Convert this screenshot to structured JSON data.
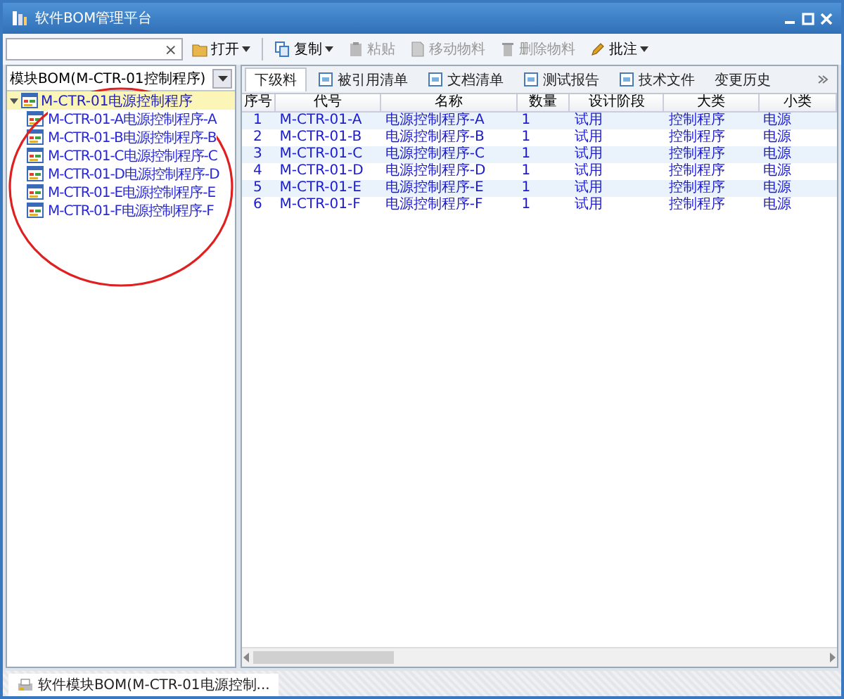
{
  "window": {
    "title": "软件BOM管理平台"
  },
  "toolbar": {
    "search": {
      "clear": "×"
    },
    "buttons": [
      {
        "label": "打开",
        "kind": "folder",
        "dropdown": true,
        "disabled": false
      },
      {
        "label": "复制",
        "kind": "copy",
        "dropdown": true,
        "disabled": false
      },
      {
        "label": "粘贴",
        "kind": "paste",
        "dropdown": false,
        "disabled": true
      },
      {
        "label": "移动物料",
        "kind": "doc",
        "dropdown": false,
        "disabled": true
      },
      {
        "label": "删除物料",
        "kind": "trash",
        "dropdown": false,
        "disabled": true
      },
      {
        "label": "批注",
        "kind": "note",
        "dropdown": true,
        "disabled": false
      }
    ]
  },
  "left_panel": {
    "selector": {
      "value": "模块BOM(M-CTR-01控制程序)"
    },
    "tree": [
      {
        "label": "M-CTR-01电源控制程序",
        "expanded": true,
        "children": [
          {
            "label": "M-CTR-01-A电源控制程序-A"
          },
          {
            "label": "M-CTR-01-B电源控制程序-B"
          },
          {
            "label": "M-CTR-01-C电源控制程序-C"
          },
          {
            "label": "M-CTR-01-D电源控制程序-D"
          },
          {
            "label": "M-CTR-01-E电源控制程序-E"
          },
          {
            "label": "M-CTR-01-F电源控制程序-F"
          }
        ]
      }
    ]
  },
  "tabs": [
    {
      "label": "下级料",
      "icon": false,
      "selected": true
    },
    {
      "label": "被引用清单",
      "icon": true,
      "selected": false
    },
    {
      "label": "文档清单",
      "icon": true,
      "selected": false
    },
    {
      "label": "测试报告",
      "icon": true,
      "selected": false
    },
    {
      "label": "技术文件",
      "icon": true,
      "selected": false
    },
    {
      "label": "变更历史",
      "icon": false,
      "selected": false
    }
  ],
  "table": {
    "columns": [
      "序号",
      "代号",
      "名称",
      "数量",
      "设计阶段",
      "大类",
      "小类"
    ],
    "rows": [
      [
        "1",
        "M-CTR-01-A",
        "电源控制程序-A",
        "1",
        "试用",
        "控制程序",
        "电源"
      ],
      [
        "2",
        "M-CTR-01-B",
        "电源控制程序-B",
        "1",
        "试用",
        "控制程序",
        "电源"
      ],
      [
        "3",
        "M-CTR-01-C",
        "电源控制程序-C",
        "1",
        "试用",
        "控制程序",
        "电源"
      ],
      [
        "4",
        "M-CTR-01-D",
        "电源控制程序-D",
        "1",
        "试用",
        "控制程序",
        "电源"
      ],
      [
        "5",
        "M-CTR-01-E",
        "电源控制程序-E",
        "1",
        "试用",
        "控制程序",
        "电源"
      ],
      [
        "6",
        "M-CTR-01-F",
        "电源控制程序-F",
        "1",
        "试用",
        "控制程序",
        "电源"
      ]
    ]
  },
  "bottom_tabs": [
    {
      "label": "软件模块BOM(M-CTR-01电源控制...",
      "selected": true
    }
  ]
}
